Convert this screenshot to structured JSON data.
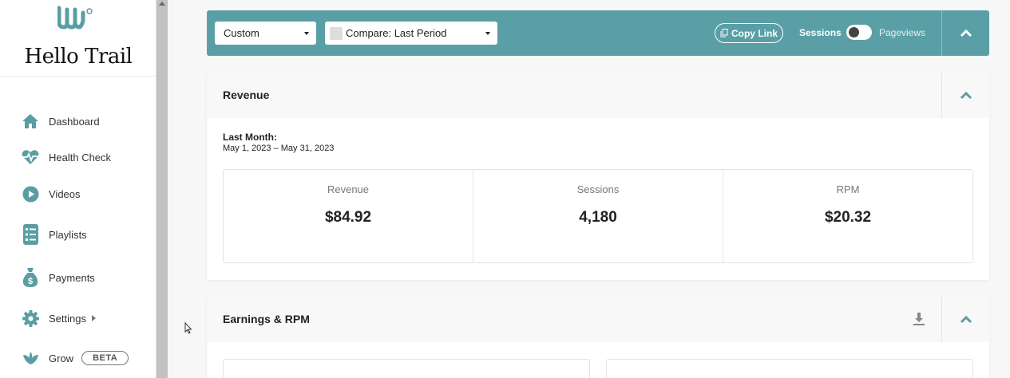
{
  "brand": {
    "name": "Hello Trail"
  },
  "sidebar": {
    "items": [
      {
        "label": "Dashboard",
        "icon": "home-icon"
      },
      {
        "label": "Health Check",
        "icon": "heartbeat-icon"
      },
      {
        "label": "Videos",
        "icon": "play-circle-icon"
      },
      {
        "label": "Playlists",
        "icon": "list-icon"
      },
      {
        "label": "Payments",
        "icon": "money-bag-icon"
      },
      {
        "label": "Settings",
        "icon": "gear-icon"
      },
      {
        "label": "Grow",
        "icon": "leaf-icon",
        "badge": "BETA"
      }
    ]
  },
  "toolbar": {
    "range_select": "Custom",
    "compare_select": "Compare: Last Period",
    "copy_link": "Copy Link",
    "toggle_left": "Sessions",
    "toggle_right": "Pageviews"
  },
  "revenue": {
    "title": "Revenue",
    "period_label": "Last Month:",
    "period_range": "May 1, 2023 – May 31, 2023",
    "stats": [
      {
        "label": "Revenue",
        "value": "$84.92"
      },
      {
        "label": "Sessions",
        "value": "4,180"
      },
      {
        "label": "RPM",
        "value": "$20.32"
      }
    ]
  },
  "earnings": {
    "title": "Earnings & RPM"
  },
  "colors": {
    "accent": "#5a9fa6",
    "icon": "#5a9ea3"
  }
}
